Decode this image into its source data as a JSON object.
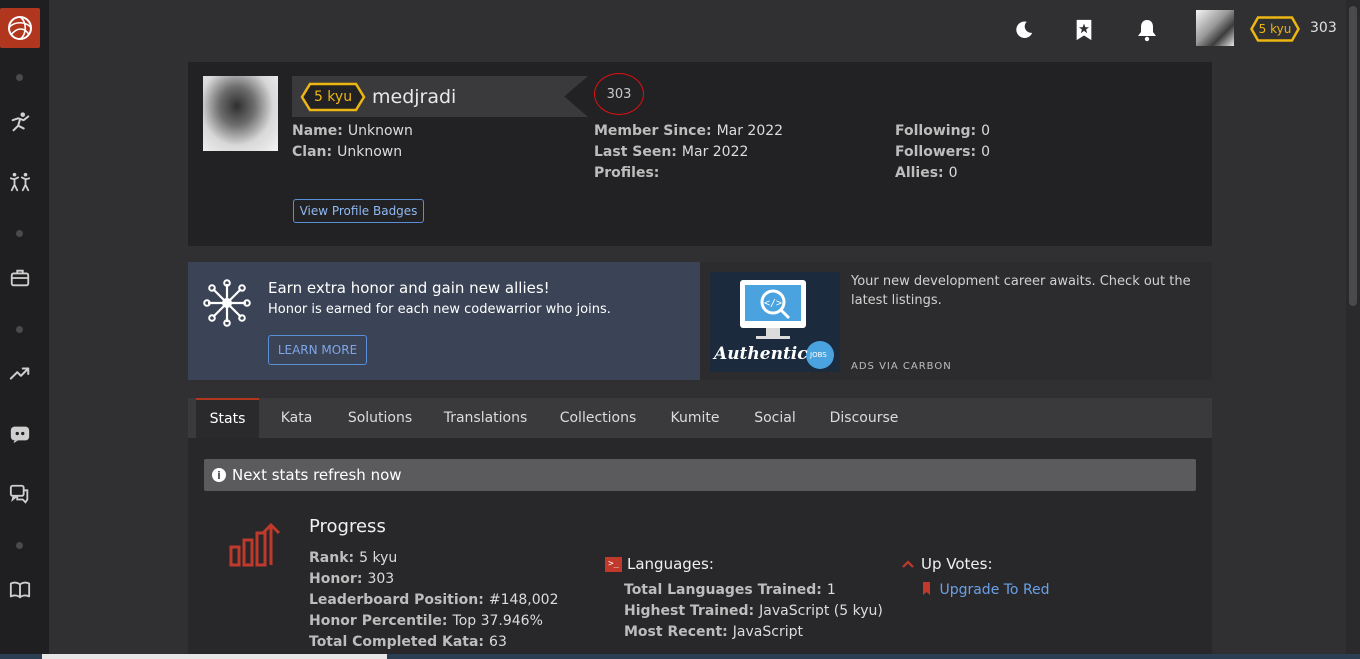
{
  "topbar": {
    "rank": "5 kyu",
    "honor": "303"
  },
  "profile": {
    "rank": "5 kyu",
    "username": "medjradi",
    "honor": "303",
    "name_label": "Name:",
    "name_value": "Unknown",
    "clan_label": "Clan:",
    "clan_value": "Unknown",
    "member_since_label": "Member Since:",
    "member_since_value": "Mar 2022",
    "last_seen_label": "Last Seen:",
    "last_seen_value": "Mar 2022",
    "profiles_label": "Profiles:",
    "following_label": "Following:",
    "following_value": "0",
    "followers_label": "Followers:",
    "followers_value": "0",
    "allies_label": "Allies:",
    "allies_value": "0",
    "badges_button": "View Profile Badges"
  },
  "honor_banner": {
    "title": "Earn extra honor and gain new allies!",
    "subtitle": "Honor is earned for each new codewarrior who joins.",
    "button": "LEARN MORE"
  },
  "ad": {
    "text": "Your new development career awaits. Check out the latest listings.",
    "via": "ADS VIA CARBON",
    "image_brand": "Authentic",
    "image_badge": "JOBS"
  },
  "tabs": [
    "Stats",
    "Kata",
    "Solutions",
    "Translations",
    "Collections",
    "Kumite",
    "Social",
    "Discourse"
  ],
  "stats": {
    "refresh": "Next stats refresh now",
    "progress_title": "Progress",
    "rank_label": "Rank:",
    "rank_value": "5 kyu",
    "honor_label": "Honor:",
    "honor_value": "303",
    "leaderboard_label": "Leaderboard Position:",
    "leaderboard_value": "#148,002",
    "percentile_label": "Honor Percentile:",
    "percentile_value": "Top 37.946%",
    "completed_label": "Total Completed Kata:",
    "completed_value": "63",
    "languages_title": "Languages:",
    "langs_trained_label": "Total Languages Trained:",
    "langs_trained_value": "1",
    "highest_label": "Highest Trained:",
    "highest_value": "JavaScript (5 kyu)",
    "recent_label": "Most Recent:",
    "recent_value": "JavaScript",
    "upvotes_title": "Up Votes:",
    "upgrade_link": "Upgrade To Red"
  },
  "colors": {
    "brand_red": "#b1361e",
    "rank_yellow": "#ecb613",
    "link_blue": "#6aa0e8"
  }
}
